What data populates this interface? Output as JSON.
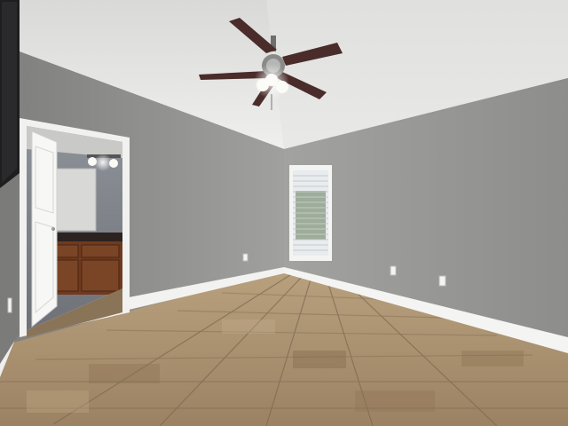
{
  "scene": {
    "description_tag": "photo",
    "watermark_text": "",
    "colors": {
      "ceiling": "#e9e9e7",
      "wall_left": "#8f8f8d",
      "wall_back": "#a3a3a1",
      "wall_right": "#989896",
      "baseboard": "#f4f4f2",
      "floor_tile": "#a88e6c",
      "cabinet": "#6e3a1f",
      "fan_blade": "#4a2c2a"
    },
    "icons": [
      "ceiling-fan-icon",
      "window-blinds-icon",
      "door-icon",
      "tv-icon",
      "light-fixture-icon"
    ]
  }
}
